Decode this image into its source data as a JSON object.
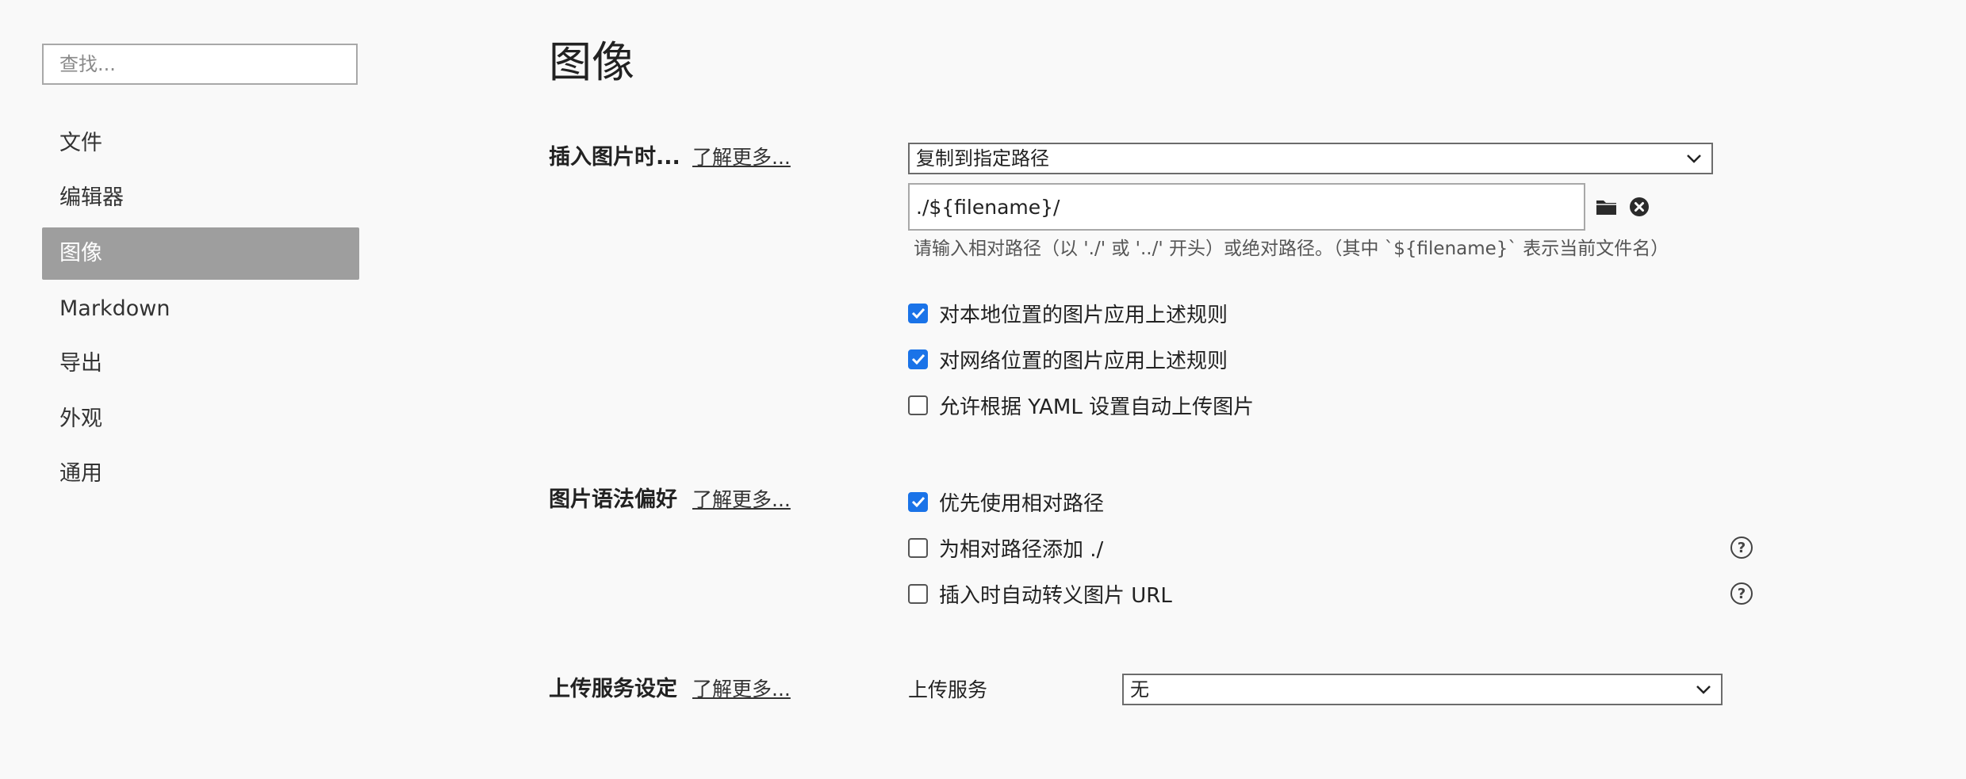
{
  "sidebar": {
    "search_placeholder": "查找...",
    "items": [
      {
        "label": "文件",
        "active": false
      },
      {
        "label": "编辑器",
        "active": false
      },
      {
        "label": "图像",
        "active": true
      },
      {
        "label": "Markdown",
        "active": false
      },
      {
        "label": "导出",
        "active": false
      },
      {
        "label": "外观",
        "active": false
      },
      {
        "label": "通用",
        "active": false
      }
    ]
  },
  "main": {
    "title": "图像",
    "insert_section": {
      "label": "插入图片时...",
      "learn_more": "了解更多...",
      "action_select": "复制到指定路径",
      "path_value": "./${filename}/",
      "hint": "请输入相对路径（以 './' 或 '../' 开头）或绝对路径。（其中 `${filename}` 表示当前文件名）",
      "checkboxes": [
        {
          "label": "对本地位置的图片应用上述规则",
          "checked": true
        },
        {
          "label": "对网络位置的图片应用上述规则",
          "checked": true
        },
        {
          "label": "允许根据 YAML 设置自动上传图片",
          "checked": false
        }
      ]
    },
    "syntax_section": {
      "label": "图片语法偏好",
      "learn_more": "了解更多...",
      "checkboxes": [
        {
          "label": "优先使用相对路径",
          "checked": true,
          "help": false
        },
        {
          "label": "为相对路径添加 ./",
          "checked": false,
          "help": true
        },
        {
          "label": "插入时自动转义图片 URL",
          "checked": false,
          "help": true
        }
      ],
      "help_glyph": "?"
    },
    "upload_section": {
      "label": "上传服务设定",
      "learn_more": "了解更多...",
      "service_label": "上传服务",
      "service_select": "无"
    }
  },
  "colors": {
    "accent": "#1a73e8",
    "sidebar_active_bg": "#9e9e9e",
    "background": "#f9f9f9"
  },
  "icons": {
    "folder": "folder-icon",
    "clear": "close-circle-icon",
    "dropdown": "chevron-down-icon",
    "checkmark": "checkmark-icon",
    "help": "question-circle-icon"
  }
}
